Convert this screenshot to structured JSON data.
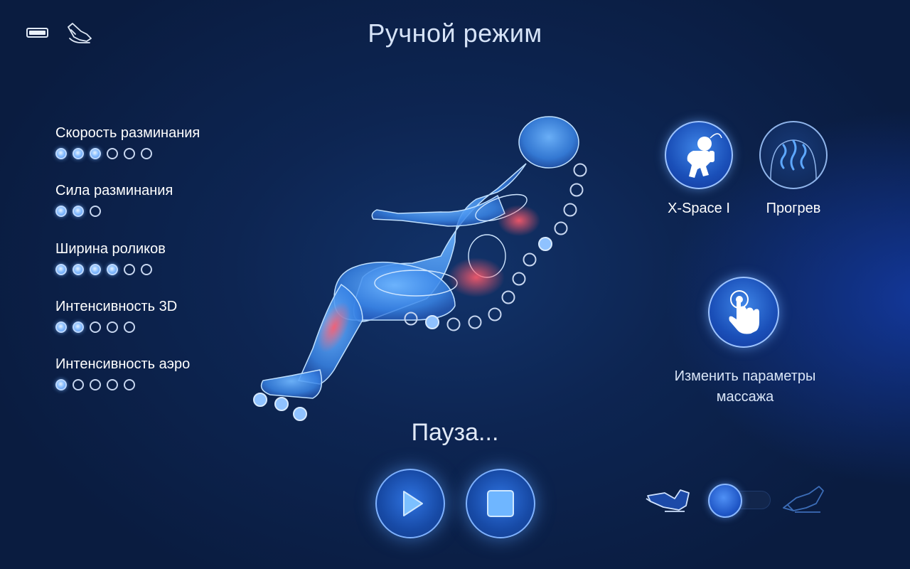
{
  "header": {
    "title": "Ручной режим",
    "battery_icon": "battery-icon",
    "chair_icon": "massage-chair-icon"
  },
  "settings": [
    {
      "label": "Скорость разминания",
      "total": 6,
      "active": 3
    },
    {
      "label": "Сила разминания",
      "total": 3,
      "active": 2
    },
    {
      "label": "Ширина роликов",
      "total": 6,
      "active": 4
    },
    {
      "label": "Интенсивность 3D",
      "total": 5,
      "active": 2
    },
    {
      "label": "Интенсивность аэро",
      "total": 5,
      "active": 1
    }
  ],
  "modes": {
    "xspace": {
      "label": "X-Space I",
      "icon": "astronaut-icon"
    },
    "warm": {
      "label": "Прогрев",
      "icon": "heat-back-icon"
    }
  },
  "change_params": {
    "label": "Изменить параметры массажа",
    "icon": "touch-hand-icon"
  },
  "status": "Пауза...",
  "controls": {
    "play_icon": "play-icon",
    "stop_icon": "stop-icon"
  },
  "recline": {
    "upright_icon": "chair-upright-icon",
    "reclined_icon": "chair-reclined-icon",
    "toggle_on": false
  },
  "colors": {
    "accent": "#3f86e8",
    "active_dot": "#8fc2ff",
    "heat_zone": "#ff5a6a",
    "background": "#0d2552"
  }
}
